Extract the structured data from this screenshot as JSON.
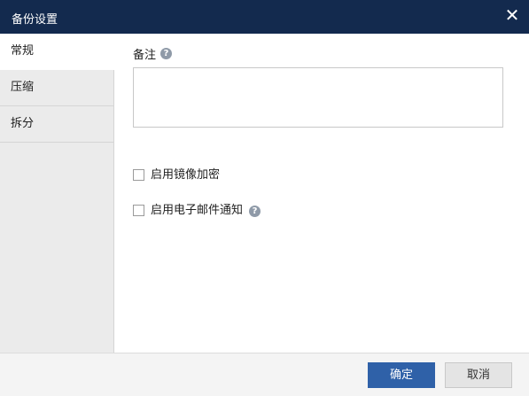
{
  "window": {
    "title": "备份设置",
    "close_glyph": "✕"
  },
  "sidebar": {
    "items": [
      {
        "label": "常规"
      },
      {
        "label": "压缩"
      },
      {
        "label": "拆分"
      }
    ]
  },
  "main": {
    "note_label": "备注",
    "help_glyph": "?",
    "note_value": "",
    "checkboxes": [
      {
        "label": "启用镜像加密",
        "checked": false
      },
      {
        "label": "启用电子邮件通知",
        "checked": false
      }
    ]
  },
  "footer": {
    "ok_label": "确定",
    "cancel_label": "取消"
  },
  "colors": {
    "titlebar": "#132a4e",
    "ok_button": "#2f61a8",
    "sidebar": "#ebebeb"
  }
}
